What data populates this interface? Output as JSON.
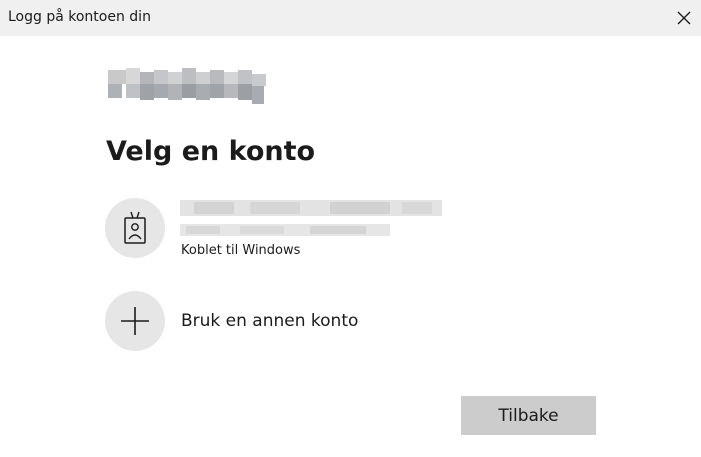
{
  "window": {
    "title": "Logg på kontoen din",
    "close_icon": "close-icon"
  },
  "logo": {
    "icon": "blurred-logo",
    "redacted": true
  },
  "heading": "Velg en konto",
  "accounts": [
    {
      "icon": "badge-icon",
      "name_redacted": true,
      "email_redacted": true,
      "status": "Koblet til Windows"
    }
  ],
  "other_account": {
    "icon": "plus-icon",
    "label": "Bruk en annen konto"
  },
  "buttons": {
    "back_label": "Tilbake"
  },
  "colors": {
    "titlebar_bg": "#f0f0f0",
    "circle_bg": "#e6e6e6",
    "button_bg": "#cccccc"
  }
}
